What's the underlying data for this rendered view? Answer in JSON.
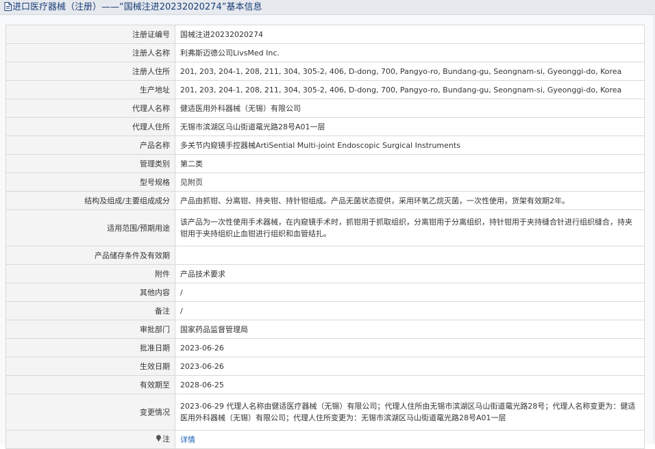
{
  "header": {
    "title": "进口医疗器械（注册）——“国械注进20232020274”基本信息"
  },
  "rows": [
    {
      "label": "注册证编号",
      "value": "国械注进20232020274"
    },
    {
      "label": "注册人名称",
      "value": "利弗斯迈德公司LivsMed Inc."
    },
    {
      "label": "注册人住所",
      "value": "201, 203, 204-1, 208, 211, 304, 305-2, 406, D-dong, 700, Pangyo-ro, Bundang-gu, Seongnam-si, Gyeonggi-do, Korea"
    },
    {
      "label": "生产地址",
      "value": "201, 203, 204-1, 208, 211, 304, 305-2, 406, D-dong, 700, Pangyo-ro, Bundang-gu, Seongnam-si, Gyeonggi-do, Korea"
    },
    {
      "label": "代理人名称",
      "value": "健适医用外科器械（无锡）有限公司"
    },
    {
      "label": "代理人住所",
      "value": "无锡市滨湖区马山街道鼋光路28号A01一层"
    },
    {
      "label": "产品名称",
      "value": "多关节内窥镜手控器械ArtiSential Multi-joint Endoscopic Surgical Instruments"
    },
    {
      "label": "管理类别",
      "value": "第二类"
    },
    {
      "label": "型号规格",
      "value": "见附页"
    },
    {
      "label": "结构及组成/主要组成成分",
      "value": "产品由抓钳、分离钳、持夹钳、持针钳组成。产品无菌状态提供，采用环氧乙烷灭菌，一次性使用，货架有效期2年。"
    },
    {
      "label": "适用范围/预期用途",
      "value": "该产品为一次性使用手术器械，在内窥镜手术时，抓钳用于抓取组织，分离钳用于分离组织，持针钳用于夹持缝合针进行组织缝合，持夹钳用于夹持组织止血钳进行组织和血管结扎。"
    },
    {
      "label": "产品储存条件及有效期",
      "value": ""
    },
    {
      "label": "附件",
      "value": "产品技术要求"
    },
    {
      "label": "其他内容",
      "value": "/"
    },
    {
      "label": "备注",
      "value": "/"
    },
    {
      "label": "审批部门",
      "value": "国家药品监督管理局"
    },
    {
      "label": "批准日期",
      "value": "2023-06-26"
    },
    {
      "label": "生效日期",
      "value": "2023-06-26"
    },
    {
      "label": "有效期至",
      "value": "2028-06-25"
    },
    {
      "label": "变更情况",
      "value": "2023-06-29 代理人名称由健适医疗器械（无锡）有限公司；代理人住所由无锡市滨湖区马山街道鼋光路28号；代理人名称变更为：健适医用外科器械（无锡）有限公司；代理人住所变更为：无锡市滨湖区马山街道鼋光路28号A01一层"
    }
  ],
  "note": {
    "label": "注",
    "link_text": "详情",
    "icon": "pin-icon"
  },
  "colors": {
    "title": "#1a3e78",
    "link": "#1a5fb4",
    "border": "#d8d8d8"
  }
}
